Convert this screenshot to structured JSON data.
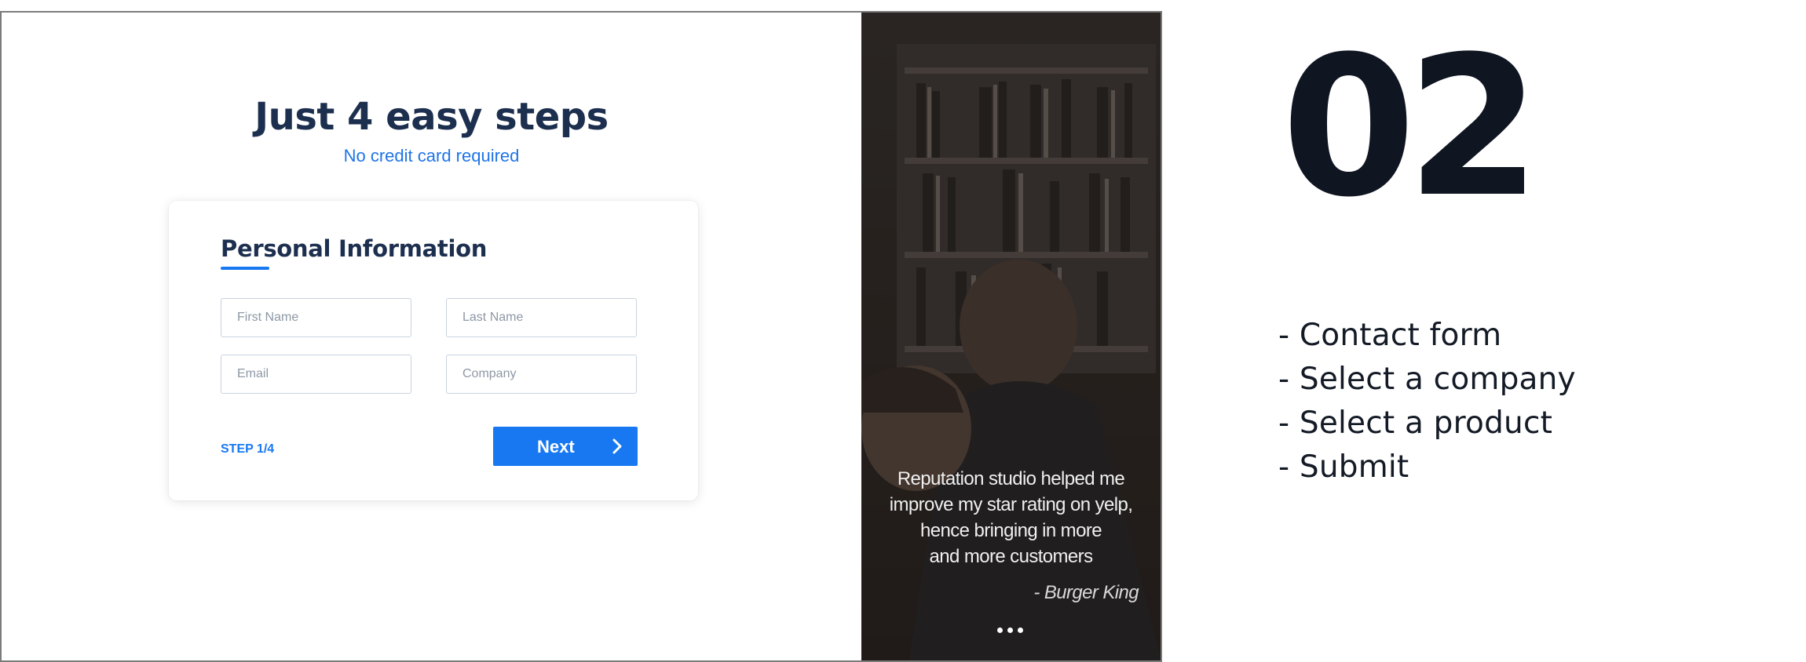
{
  "hero": {
    "title": "Just 4 easy steps",
    "subtitle": "No credit card required"
  },
  "form": {
    "title": "Personal Information",
    "fields": {
      "first_name": {
        "placeholder": "First Name",
        "value": ""
      },
      "last_name": {
        "placeholder": "Last Name",
        "value": ""
      },
      "email": {
        "placeholder": "Email",
        "value": ""
      },
      "company": {
        "placeholder": "Company",
        "value": ""
      }
    },
    "step_label": "STEP 1/4",
    "next_label": "Next",
    "next_icon": "chevron-right-icon"
  },
  "testimonial": {
    "quote_lines": [
      "Reputation studio helped me",
      "improve my star rating on yelp,",
      "hence bringing in more",
      "and more customers"
    ],
    "author": "- Burger King",
    "carousel_dots": 3
  },
  "annotation": {
    "number": "02",
    "items": [
      "- Contact form",
      "- Select a company",
      "- Select a product",
      "- Submit"
    ]
  },
  "colors": {
    "accent": "#1778f2",
    "heading": "#1d2f4f",
    "annotation_text": "#0f1521"
  }
}
